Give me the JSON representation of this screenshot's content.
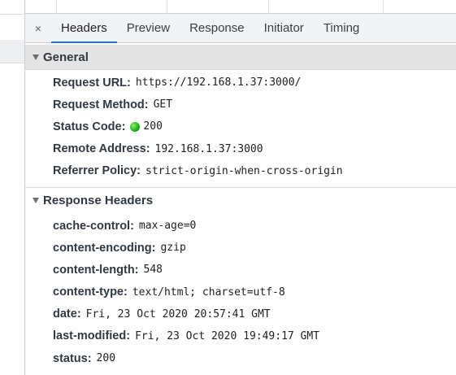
{
  "tabs": {
    "close_label": "×",
    "items": [
      {
        "label": "Headers",
        "active": true
      },
      {
        "label": "Preview",
        "active": false
      },
      {
        "label": "Response",
        "active": false
      },
      {
        "label": "Initiator",
        "active": false
      },
      {
        "label": "Timing",
        "active": false
      }
    ]
  },
  "general": {
    "title": "General",
    "request_url": {
      "key": "Request URL:",
      "value": "https://192.168.1.37:3000/"
    },
    "request_method": {
      "key": "Request Method:",
      "value": "GET"
    },
    "status_code": {
      "key": "Status Code:",
      "value": "200",
      "status_color": "#22b51e"
    },
    "remote_address": {
      "key": "Remote Address:",
      "value": "192.168.1.37:3000"
    },
    "referrer_policy": {
      "key": "Referrer Policy:",
      "value": "strict-origin-when-cross-origin"
    }
  },
  "response_headers": {
    "title": "Response Headers",
    "items": [
      {
        "key": "cache-control:",
        "value": "max-age=0"
      },
      {
        "key": "content-encoding:",
        "value": "gzip"
      },
      {
        "key": "content-length:",
        "value": "548"
      },
      {
        "key": "content-type:",
        "value": "text/html; charset=utf-8"
      },
      {
        "key": "date:",
        "value": "Fri, 23 Oct 2020 20:57:41 GMT"
      },
      {
        "key": "last-modified:",
        "value": "Fri, 23 Oct 2020 19:49:17 GMT"
      },
      {
        "key": "status:",
        "value": "200"
      }
    ]
  },
  "colors": {
    "accent": "#1a73e8",
    "section_bg": "#e4e4e4",
    "tabbar_bg": "#f1f3f4"
  }
}
